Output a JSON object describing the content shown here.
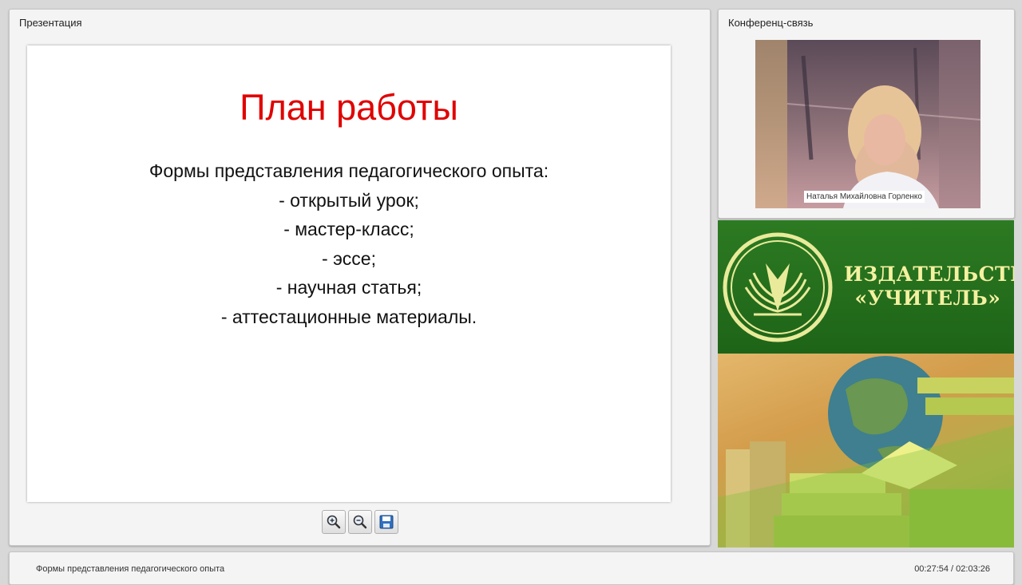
{
  "presentation": {
    "panel_title": "Презентация",
    "slide": {
      "title": "План работы",
      "lines": [
        "Формы представления педагогического опыта:",
        "- открытый урок;",
        "- мастер-класс;",
        "- эссе;",
        "- научная статья;",
        "- аттестационные материалы."
      ]
    },
    "toolbar": {
      "zoom_in_icon": "zoom-in-icon",
      "zoom_out_icon": "zoom-out-icon",
      "save_icon": "floppy-disk-icon"
    }
  },
  "conference": {
    "panel_title": "Конференц-связь",
    "participant_name": "Наталья Михайловна Горленко"
  },
  "banner": {
    "publisher_line1": "ИЗДАТЕЛЬСТВО",
    "publisher_line2": "«УЧИТЕЛЬ»",
    "colors": {
      "green": "#2c7a22",
      "text": "#f4f1a0"
    }
  },
  "footer": {
    "slide_title": "Формы представления педагогического опыта",
    "time": "00:27:54 / 02:03:26"
  }
}
